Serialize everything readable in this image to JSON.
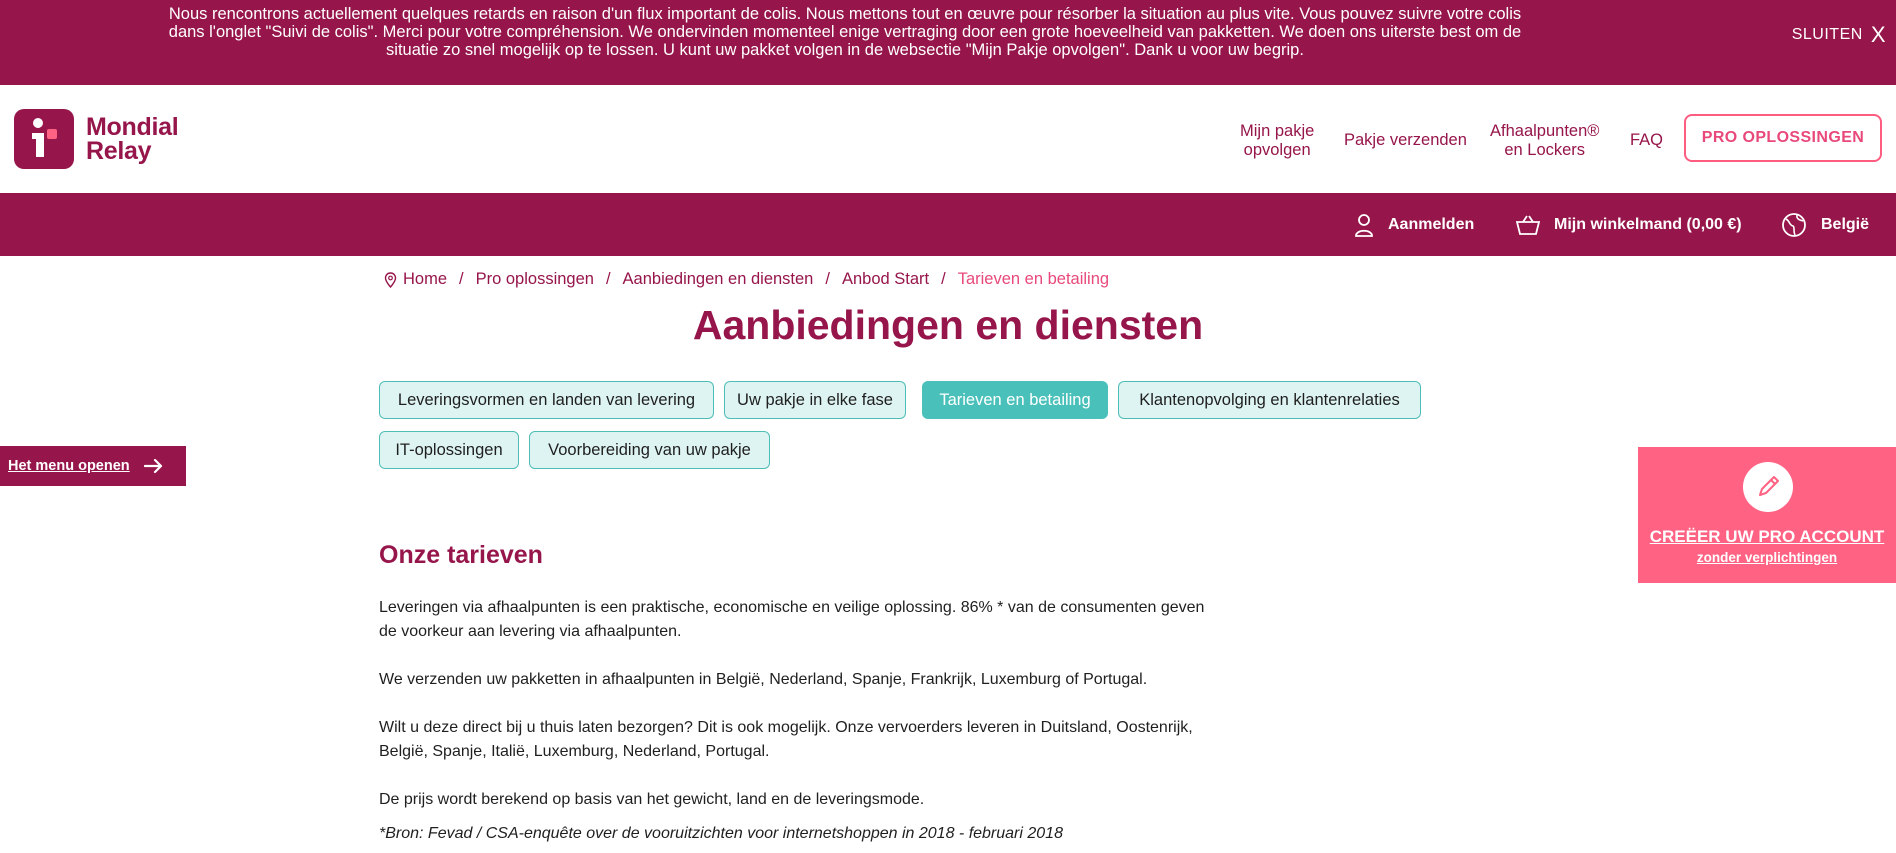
{
  "banner": {
    "text": "Nous rencontrons actuellement quelques retards en raison d'un flux important de colis. Nous mettons tout en œuvre pour résorber la situation au plus vite. Vous pouvez suivre votre colis dans l'onglet \"Suivi de colis\". Merci pour votre compréhension. We ondervinden momenteel enige vertraging door een grote hoeveelheid van pakketten. We doen ons uiterste best om de situatie zo snel mogelijk op te lossen. U kunt uw pakket volgen in de websectie \"Mijn Pakje opvolgen\". Dank u voor uw begrip.",
    "close_label": "SLUITEN",
    "close_icon": "X"
  },
  "logo": {
    "line1": "Mondial",
    "line2": "Relay"
  },
  "nav": {
    "track_line1": "Mijn pakje",
    "track_line2": "opvolgen",
    "send": "Pakje verzenden",
    "pickup_line1": "Afhaalpunten®",
    "pickup_line2": "en Lockers",
    "faq": "FAQ",
    "pro": "PRO OPLOSSINGEN"
  },
  "subbar": {
    "login": "Aanmelden",
    "cart": "Mijn winkelmand (0,00 €)",
    "country": "België"
  },
  "breadcrumb": {
    "home": "Home",
    "items": [
      "Pro oplossingen",
      "Aanbiedingen en diensten",
      "Anbod Start"
    ],
    "current": "Tarieven en betailing",
    "separator": "/"
  },
  "page": {
    "title": "Aanbiedingen en diensten"
  },
  "tabs": [
    "Leveringsvormen en landen van levering",
    "Uw pakje in elke fase",
    "Tarieven en betailing",
    "Klantenopvolging en klantenrelaties",
    "IT-oplossingen",
    "Voorbereiding van uw pakje"
  ],
  "side_menu": {
    "label": "Het menu openen"
  },
  "pro_card": {
    "title": "CREËER UW PRO ACCOUNT",
    "subtitle": "zonder verplichtingen"
  },
  "content": {
    "section_title": "Onze tarieven",
    "p1": "Leveringen via afhaalpunten is een praktische, economische en veilige oplossing. 86% * van de consumenten geven de voorkeur aan levering via afhaalpunten.",
    "p2": "We verzenden uw pakketten in afhaalpunten in België, Nederland, Spanje, Frankrijk, Luxemburg of Portugal.",
    "p3": "Wilt u deze direct bij u thuis laten bezorgen? Dit is ook mogelijk. Onze vervoerders leveren in Duitsland, Oostenrijk, België, Spanje, Italië, Luxemburg, Nederland, Portugal.",
    "p4": "De prijs wordt berekend op basis van het gewicht, land en de leveringsmode.",
    "source": "*Bron: Fevad / CSA-enquête over de vooruitzichten voor internetshoppen in 2018 - februari 2018"
  },
  "colors": {
    "brand": "#96154a",
    "pink": "#ff6283",
    "teal": "#49c0ba",
    "teal_light": "#ddf4f2"
  }
}
